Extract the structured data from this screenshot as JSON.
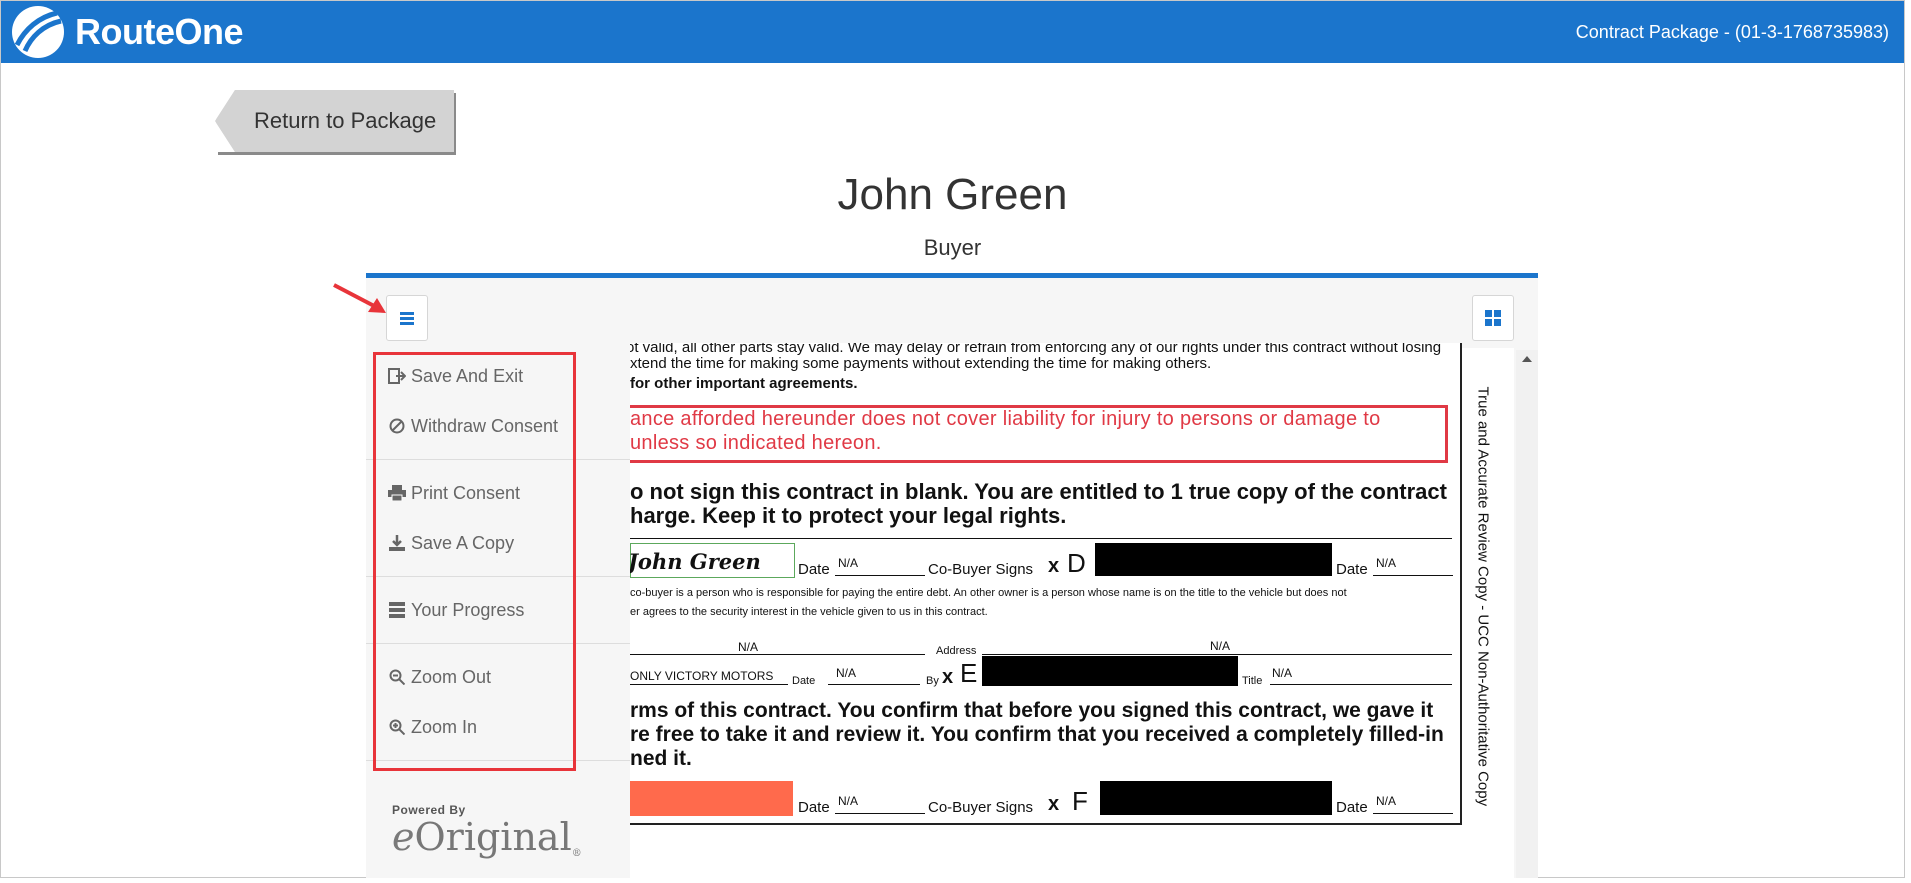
{
  "header": {
    "brand": "RouteOne",
    "package_title": "Contract Package - (01-3-1768735983)"
  },
  "navigation": {
    "return_label": "Return to Package"
  },
  "signer": {
    "name": "John Green",
    "role": "Buyer"
  },
  "side_menu": {
    "groups": [
      [
        {
          "label": "Save And Exit",
          "icon": "sign-out-icon"
        },
        {
          "label": "Withdraw Consent",
          "icon": "ban-icon"
        }
      ],
      [
        {
          "label": "Print Consent",
          "icon": "print-icon"
        },
        {
          "label": "Save A Copy",
          "icon": "download-icon"
        }
      ],
      [
        {
          "label": "Your Progress",
          "icon": "server-icon"
        }
      ],
      [
        {
          "label": "Zoom Out",
          "icon": "zoom-out-icon"
        },
        {
          "label": "Zoom In",
          "icon": "zoom-in-icon"
        }
      ]
    ],
    "powered_by_label": "Powered By",
    "powered_by_brand_e": "e",
    "powered_by_brand_rest": "Original",
    "powered_by_reg": "®"
  },
  "document": {
    "line1": "ot valid, all other parts stay valid. We may delay or refrain from enforcing any of our rights under this contract without losing",
    "line2": "xtend the time for making some payments without extending the time for making others.",
    "line3": "for other important agreements.",
    "red_line1": "ance afforded hereunder does not cover liability for injury to persons or damage to",
    "red_line2": "unless so indicated hereon.",
    "blank_line1": "o not sign this contract in blank. You are entitled to 1 true copy of the contract",
    "blank_line2": "harge. Keep it to protect your legal rights.",
    "signature": "John Green",
    "date_label": "Date",
    "na": "N/A",
    "cobuyer_label": "Co-Buyer Signs",
    "x_mark": "x",
    "letter_d": "D",
    "letter_e": "E",
    "letter_f": "F",
    "fine1": "co-buyer is a person who is responsible for paying the entire debt. An other owner is a person whose name is on the title to the vehicle but does not",
    "fine2": "er agrees to the security interest in the vehicle given to us in this contract.",
    "address_label": "Address",
    "by_label": "By",
    "title_label": "Title",
    "dealer": "ONLY VICTORY MOTORS",
    "terms_line1": "rms of this contract. You confirm that before you signed this contract, we gave it",
    "terms_line2": "re free to take it and review it. You confirm that you received a completely filled-in",
    "terms_line3": "ned it.",
    "side_label": "True and Accurate Review Copy - UCC Non-Authoritative Copy"
  },
  "colors": {
    "brand_blue": "#1b75cc",
    "highlight_red": "#e8343a",
    "signature_orange": "#ff6a4c"
  }
}
